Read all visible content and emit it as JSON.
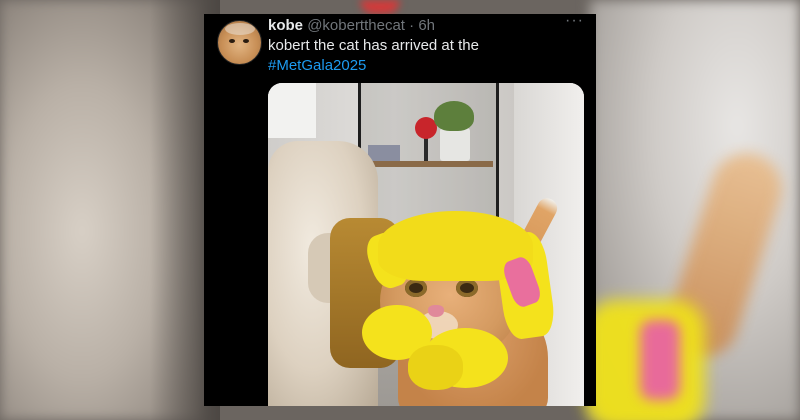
{
  "tweet": {
    "display_name": "kobe",
    "handle": "@kobertthecat",
    "separator": "·",
    "time": "6h",
    "more_icon": "more-horizontal-icon",
    "text": "kobert the cat has arrived at the",
    "hashtag": "#MetGala2025",
    "hashtag_color": "#1d9bf0"
  },
  "colors": {
    "card_background": "#000000",
    "primary_text": "#e7e9ea",
    "secondary_text": "#71767b"
  }
}
